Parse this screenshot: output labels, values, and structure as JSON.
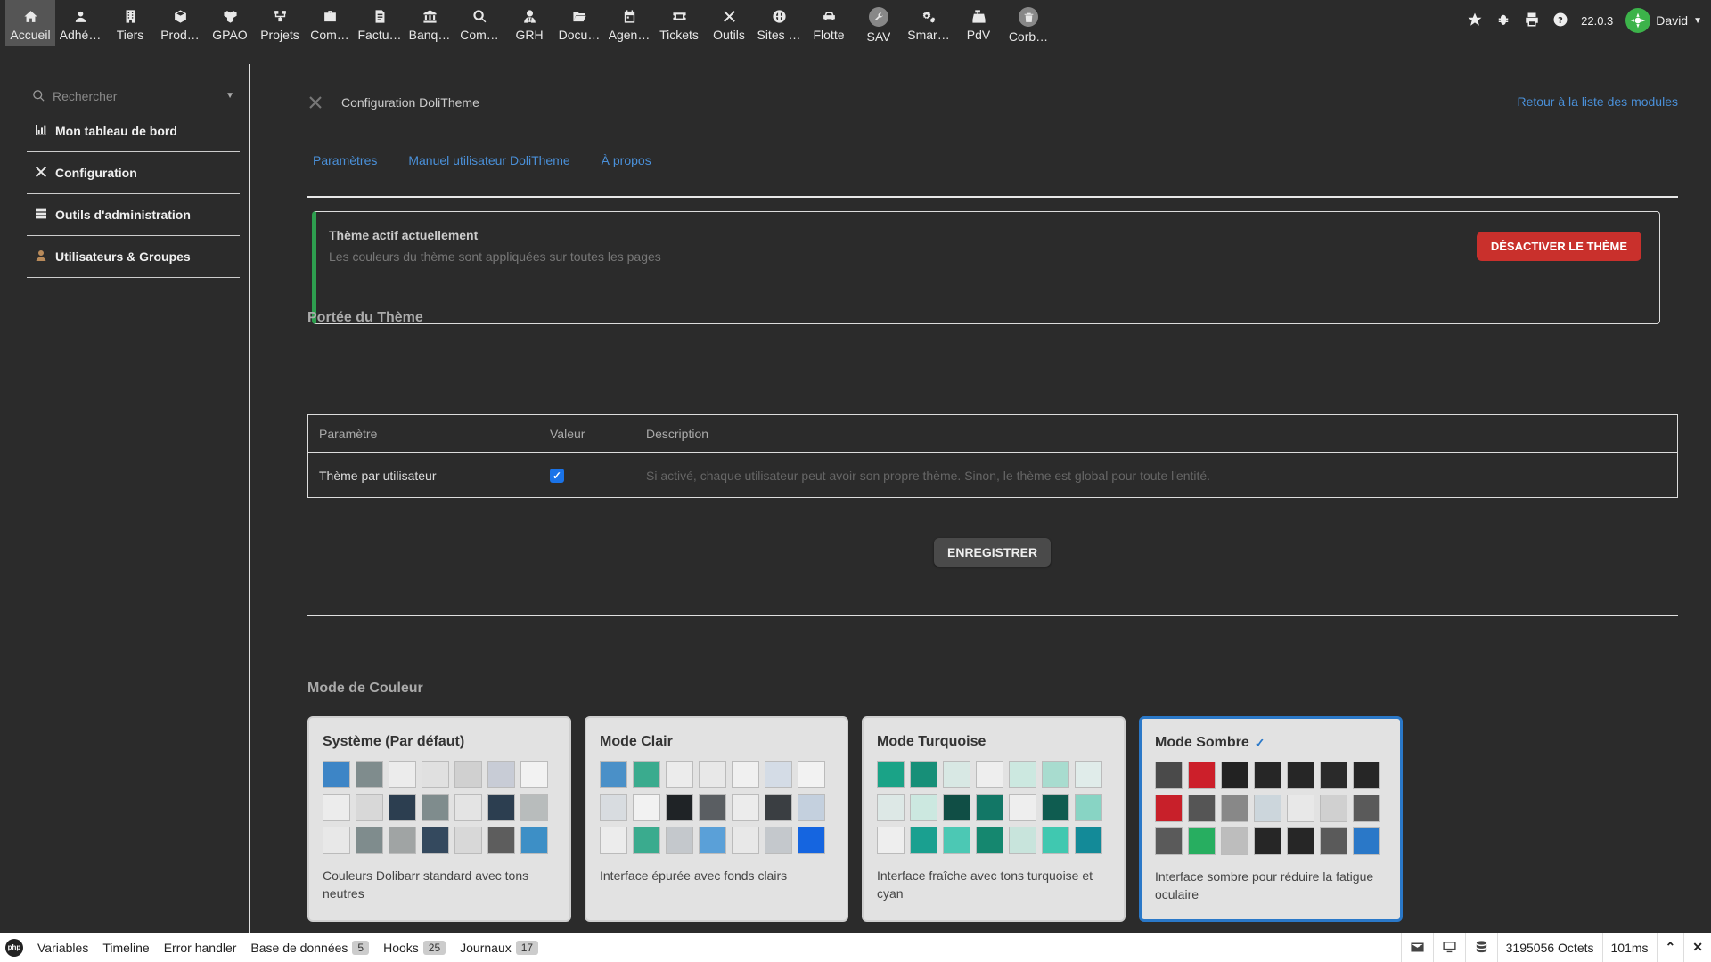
{
  "topmenu": {
    "items": [
      {
        "label": "Accueil",
        "icon": "home-icon",
        "active": true
      },
      {
        "label": "Adhé…",
        "icon": "member-icon"
      },
      {
        "label": "Tiers",
        "icon": "building-icon"
      },
      {
        "label": "Prod…",
        "icon": "cube-icon"
      },
      {
        "label": "GPAO",
        "icon": "cubes-icon"
      },
      {
        "label": "Projets",
        "icon": "project-icon"
      },
      {
        "label": "Com…",
        "icon": "briefcase-icon"
      },
      {
        "label": "Factu…",
        "icon": "invoice-icon"
      },
      {
        "label": "Banq…",
        "icon": "bank-icon"
      },
      {
        "label": "Com…",
        "icon": "search-dollar-icon"
      },
      {
        "label": "GRH",
        "icon": "user-tie-icon"
      },
      {
        "label": "Docu…",
        "icon": "folder-open-icon"
      },
      {
        "label": "Agen…",
        "icon": "calendar-icon"
      },
      {
        "label": "Tickets",
        "icon": "ticket-icon"
      },
      {
        "label": "Outils",
        "icon": "tools-icon"
      },
      {
        "label": "Sites …",
        "icon": "globe-icon"
      },
      {
        "label": "Flotte",
        "icon": "car-icon"
      },
      {
        "label": "SAV",
        "icon": "wrench-icon"
      },
      {
        "label": "Smar…",
        "icon": "cogs-icon"
      },
      {
        "label": "PdV",
        "icon": "cash-register-icon"
      },
      {
        "label": "Corb…",
        "icon": "trash-icon"
      }
    ],
    "version": "22.0.3",
    "user": "David"
  },
  "sidebar": {
    "search_placeholder": "Rechercher",
    "items": [
      {
        "label": "Mon tableau de bord",
        "icon": "chart-icon"
      },
      {
        "label": "Configuration",
        "icon": "tools-icon"
      },
      {
        "label": "Outils d'administration",
        "icon": "server-icon"
      },
      {
        "label": "Utilisateurs & Groupes",
        "icon": "user-icon"
      }
    ]
  },
  "main": {
    "title": "Configuration DoliTheme",
    "back_link": "Retour à la liste des modules",
    "tabs": [
      "Paramètres",
      "Manuel utilisateur DoliTheme",
      "À propos"
    ],
    "active_theme": {
      "title": "Thème actif actuellement",
      "description": "Les couleurs du thème sont appliquées sur toutes les pages",
      "deactivate_label": "DÉSACTIVER LE THÈME"
    },
    "scope": {
      "title": "Portée du Thème",
      "headers": [
        "Paramètre",
        "Valeur",
        "Description"
      ],
      "rows": [
        {
          "param": "Thème par utilisateur",
          "checked": true,
          "description": "Si activé, chaque utilisateur peut avoir son propre thème. Sinon, le thème est global pour toute l'entité."
        }
      ],
      "save_label": "ENREGISTRER"
    },
    "color_mode": {
      "title": "Mode de Couleur",
      "cards": [
        {
          "title": "Système (Par défaut)",
          "selected": false,
          "description": "Couleurs Dolibarr standard avec tons neutres",
          "swatches": [
            "#3d85c6",
            "#7f8c8d",
            "#ececec",
            "#e0e0e0",
            "#d0d0d0",
            "#c8ccd6",
            "#f2f2f2",
            "#ececec",
            "#d8d8d8",
            "#2c3e50",
            "#7f8c8d",
            "#e4e4e4",
            "#2c3e50",
            "#b8bcbc",
            "#e8e8e8",
            "#7f8c8d",
            "#a0a4a4",
            "#34495e",
            "#d8d8d8",
            "#5d5d5d",
            "#3d8fc6"
          ]
        },
        {
          "title": "Mode Clair",
          "selected": false,
          "description": "Interface épurée avec fonds clairs",
          "swatches": [
            "#4a90c8",
            "#3aab8e",
            "#ececec",
            "#e8e8e8",
            "#f0f0f0",
            "#d4dce6",
            "#f2f2f2",
            "#d8dce0",
            "#f2f2f2",
            "#1f2326",
            "#5a5e62",
            "#ececec",
            "#3a3e42",
            "#c4d0de",
            "#ececec",
            "#3aab8e",
            "#c4c8cc",
            "#5aa0d8",
            "#e8e8e8",
            "#c4c8cc",
            "#1565e0"
          ]
        },
        {
          "title": "Mode Turquoise",
          "selected": false,
          "description": "Interface fraîche avec tons turquoise et cyan",
          "swatches": [
            "#1aa387",
            "#178f78",
            "#d8e8e4",
            "#eeeeee",
            "#cce8e0",
            "#a8dccf",
            "#e0ecea",
            "#dde8e6",
            "#cce8e0",
            "#104e45",
            "#127766",
            "#eeeeee",
            "#0f5c50",
            "#88d4c4",
            "#eeeeee",
            "#1aa090",
            "#4cc8b4",
            "#15876f",
            "#c8e4dc",
            "#40c8b0",
            "#138a98"
          ]
        },
        {
          "title": "Mode Sombre",
          "selected": true,
          "description": "Interface sombre pour réduire la fatigue oculaire",
          "swatches": [
            "#4a4a4a",
            "#cc1f2a",
            "#222222",
            "#262626",
            "#262626",
            "#2a2a2a",
            "#262626",
            "#c8202a",
            "#555555",
            "#888888",
            "#ccd6dc",
            "#e8e8e8",
            "#d0d0d0",
            "#5a5a5a",
            "#5a5a5a",
            "#27ae60",
            "#bdbdbd",
            "#262626",
            "#262626",
            "#5a5a5a",
            "#2a78c8"
          ]
        }
      ]
    }
  },
  "debugbar": {
    "items": [
      {
        "label": "Variables"
      },
      {
        "label": "Timeline"
      },
      {
        "label": "Error handler"
      },
      {
        "label": "Base de données",
        "badge": "5"
      },
      {
        "label": "Hooks",
        "badge": "25"
      },
      {
        "label": "Journaux",
        "badge": "17"
      }
    ],
    "memory": "3195056 Octets",
    "time": "101ms"
  }
}
